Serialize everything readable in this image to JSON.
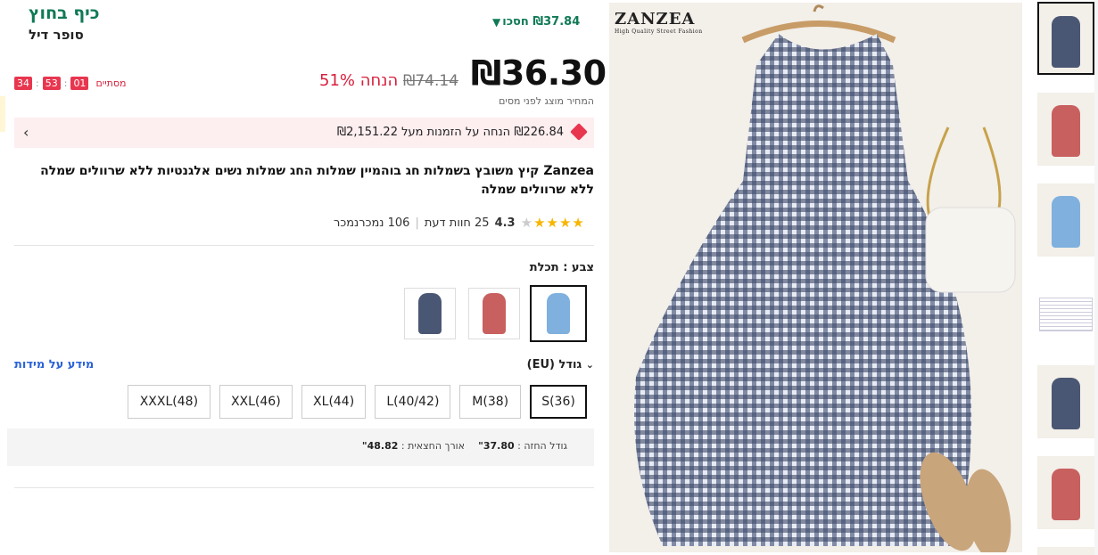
{
  "promo": {
    "title": "כיף בחוץ",
    "subtitle": "סופר דיל"
  },
  "savings_tag": "₪37.84 חסכו",
  "price": {
    "current": "₪36.30",
    "original": "₪74.14",
    "discount": "51% הנחה",
    "tax_note": "המחיר מוצג לפני מסים"
  },
  "timer": {
    "label": "מסתיים",
    "hours": "01",
    "minutes": "53",
    "seconds": "34"
  },
  "coupon": {
    "text": "₪226.84 הנחה על הזמנות מעל ₪2,151.22"
  },
  "product": {
    "title": "Zanzea קיץ משובץ בשמלות חג בוהמיין שמלות החג שמלות נשים אלגנטיות ללא שרוולים שמלה ללא שרוולים שמלה",
    "rating": "4.3",
    "rating_value": 4.3,
    "reviews": "25 חוות דעת",
    "sold": "106 נמכרנמכר"
  },
  "color": {
    "label": "צבע : תכלת",
    "options": [
      {
        "name": "תכלת",
        "hex": "#7fb0de",
        "selected": true
      },
      {
        "name": "red",
        "hex": "#c8605f",
        "selected": false
      },
      {
        "name": "navy",
        "hex": "#4a5774",
        "selected": false
      }
    ]
  },
  "size": {
    "label": "גודל (EU)",
    "guide_link": "מידע על מידות",
    "options": [
      {
        "label": "S(36)",
        "selected": true
      },
      {
        "label": "M(38)",
        "selected": false
      },
      {
        "label": "L(40/42)",
        "selected": false
      },
      {
        "label": "XL(44)",
        "selected": false
      },
      {
        "label": "XXL(46)",
        "selected": false
      },
      {
        "label": "XXXL(48)",
        "selected": false
      }
    ],
    "measure_bust_label": "גודל החזה :",
    "measure_bust_value": "37.80\"",
    "measure_hem_label": "אורך החצאית :",
    "measure_hem_value": "48.82\""
  },
  "images": {
    "logo_text": "ZANZEA",
    "logo_tagline": "High Quality Street Fashion",
    "thumb_colors": [
      "#4a5774",
      "#c8605f",
      "#7fb0de",
      "#ffffff",
      "#4a5774",
      "#c8605f"
    ]
  }
}
